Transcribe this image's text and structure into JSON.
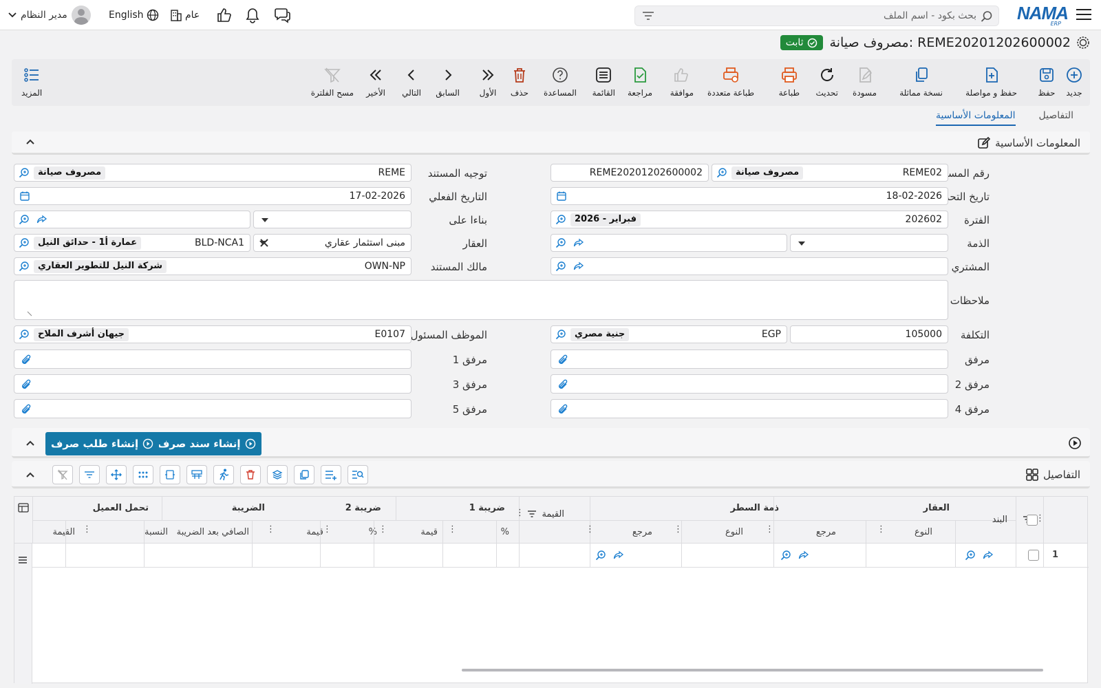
{
  "topbar": {
    "logo": "NAMA",
    "logo_sub": "ERP",
    "search_placeholder": "بحث بكود - اسم الملف",
    "language": "English",
    "company": "عام",
    "user": "مدير النظام"
  },
  "page": {
    "title": "مصروف صيانة: REME20201202600002",
    "status": "ثابت"
  },
  "toolbar": {
    "new": "جديد",
    "save": "حفظ",
    "save_continue": "حفظ و مواصلة",
    "duplicate": "نسخة مماثلة",
    "draft": "مسودة",
    "refresh": "تحديث",
    "print": "طباعة",
    "multi_print": "طباعة متعددة",
    "approve": "موافقة",
    "review": "مراجعة",
    "list": "القائمة",
    "help": "المساعدة",
    "delete": "حذف",
    "first": "الأول",
    "previous": "السابق",
    "next": "التالي",
    "last": "الأخير",
    "clear_filter": "مسح الفلترة",
    "more": "المزيد"
  },
  "tabs": {
    "basic": "المعلومات الأساسية",
    "details": "التفاصيل"
  },
  "section_basic": "المعلومات الأساسية",
  "fields": {
    "doc_no_label": "رقم المستند",
    "doc_no_code": "REME02",
    "doc_no_name": "مصروف صيانة",
    "doc_no_value": "REME20201202600002",
    "direction_label": "توجيه المستند",
    "direction_code": "REME",
    "direction_name": "مصروف صيانة",
    "edit_date_label": "تاريخ التحرير",
    "edit_date": "18-02-2026",
    "actual_date_label": "التاريخ الفعلي",
    "actual_date": "17-02-2026",
    "period_label": "الفترة",
    "period_code": "202602",
    "period_name": "2026 - فبراير",
    "based_on_label": "بناءا على",
    "account_label": "الذمة",
    "property_label": "العقار",
    "property_type": "مبنى استثمار عقاري",
    "property_code": "BLD-NCA1",
    "property_name": "عمارة أ1 - حدائق النيل",
    "buyer_label": "المشتري",
    "owner_label": "مالك المستند",
    "owner_code": "OWN-NP",
    "owner_name": "شركة النيل للتطوير العقاري",
    "notes_label": "ملاحظات",
    "cost_label": "التكلفة",
    "cost_value": "105000",
    "currency_code": "EGP",
    "currency_name": "جنية مصري",
    "employee_label": "الموظف المسئول",
    "employee_code": "E0107",
    "employee_name": "جيهان أشرف الملاح",
    "att": "مرفق",
    "att1": "مرفق 1",
    "att2": "مرفق 2",
    "att3": "مرفق 3",
    "att4": "مرفق 4",
    "att5": "مرفق 5"
  },
  "actions": {
    "create_voucher": "إنشاء سند صرف",
    "create_request": "إنشاء طلب صرف"
  },
  "section_details": "التفاصيل",
  "grid": {
    "item": "البند",
    "property": "العقار",
    "type": "النوع",
    "ref": "مرجع",
    "line_account": "ذمة السطر",
    "value": "القيمة",
    "tax1": "ضريبة 1",
    "tax2": "ضريبة 2",
    "tax": "الضريبة",
    "pct": "%",
    "amount": "قيمة",
    "net_after_tax": "الصافي بعد الضريبة",
    "customer_share": "تحمل العميل",
    "ratio": "النسبة",
    "row1": "1"
  }
}
